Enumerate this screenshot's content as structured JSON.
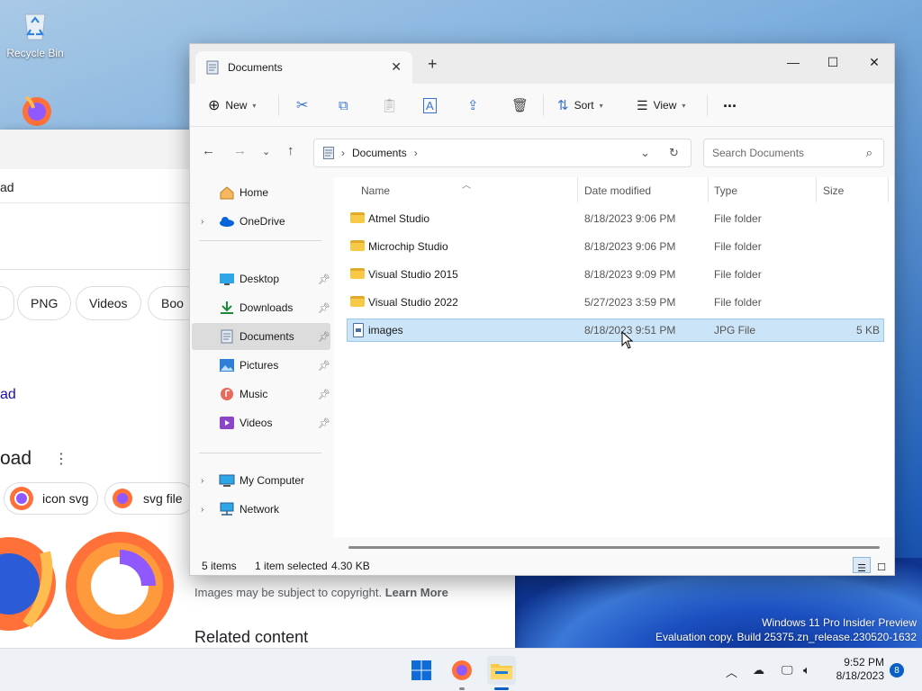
{
  "desktop": {
    "recycle_bin_label": "Recycle Bin",
    "watermark_line1": "Windows 11 Pro Insider Preview",
    "watermark_line2": "Evaluation copy. Build 25375.zn_release.230520-1632"
  },
  "browser": {
    "search_fragment": "ad",
    "chips": [
      "PNG",
      "Videos",
      "Boo"
    ],
    "link_fragment": "ad",
    "heading_fragment": "oad",
    "suggestions": [
      "icon svg",
      "svg file"
    ],
    "copyright_text": "Images may be subject to copyright.",
    "learn_more": "Learn More",
    "related_content": "Related content"
  },
  "explorer": {
    "tab_title": "Documents",
    "toolbar": {
      "new_label": "New",
      "sort_label": "Sort",
      "view_label": "View",
      "more_label": "..."
    },
    "address": {
      "segment": "Documents",
      "search_placeholder": "Search Documents"
    },
    "nav": {
      "home": "Home",
      "onedrive": "OneDrive",
      "quick": [
        {
          "label": "Desktop",
          "icon": "desktop-icon"
        },
        {
          "label": "Downloads",
          "icon": "downloads-icon"
        },
        {
          "label": "Documents",
          "icon": "documents-icon"
        },
        {
          "label": "Pictures",
          "icon": "pictures-icon"
        },
        {
          "label": "Music",
          "icon": "music-icon"
        },
        {
          "label": "Videos",
          "icon": "videos-icon"
        }
      ],
      "my_computer": "My Computer",
      "network": "Network"
    },
    "columns": {
      "name": "Name",
      "date": "Date modified",
      "type": "Type",
      "size": "Size"
    },
    "files": [
      {
        "name": "Atmel Studio",
        "date": "8/18/2023 9:06 PM",
        "type": "File folder",
        "size": "",
        "kind": "folder"
      },
      {
        "name": "Microchip Studio",
        "date": "8/18/2023 9:06 PM",
        "type": "File folder",
        "size": "",
        "kind": "folder"
      },
      {
        "name": "Visual Studio 2015",
        "date": "8/18/2023 9:09 PM",
        "type": "File folder",
        "size": "",
        "kind": "folder"
      },
      {
        "name": "Visual Studio 2022",
        "date": "5/27/2023 3:59 PM",
        "type": "File folder",
        "size": "",
        "kind": "folder"
      },
      {
        "name": "images",
        "date": "8/18/2023 9:51 PM",
        "type": "JPG File",
        "size": "5 KB",
        "kind": "file",
        "selected": true
      }
    ],
    "status": {
      "items": "5 items",
      "selected": "1 item selected",
      "size": "4.30 KB"
    }
  },
  "taskbar": {
    "time": "9:52 PM",
    "date": "8/18/2023",
    "notification_count": "8"
  },
  "colors": {
    "accent": "#0a5fc4",
    "selection": "#cce4f7",
    "folder": "#f8c947"
  }
}
